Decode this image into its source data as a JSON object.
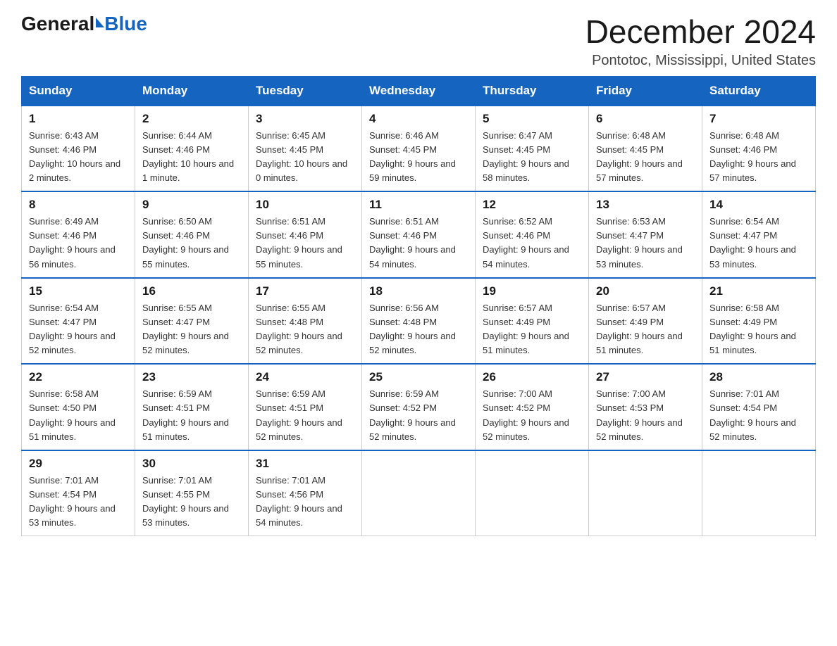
{
  "logo": {
    "general": "General",
    "blue": "Blue"
  },
  "header": {
    "month_title": "December 2024",
    "location": "Pontotoc, Mississippi, United States"
  },
  "days_of_week": [
    "Sunday",
    "Monday",
    "Tuesday",
    "Wednesday",
    "Thursday",
    "Friday",
    "Saturday"
  ],
  "weeks": [
    [
      {
        "day": "1",
        "sunrise": "6:43 AM",
        "sunset": "4:46 PM",
        "daylight": "10 hours and 2 minutes."
      },
      {
        "day": "2",
        "sunrise": "6:44 AM",
        "sunset": "4:46 PM",
        "daylight": "10 hours and 1 minute."
      },
      {
        "day": "3",
        "sunrise": "6:45 AM",
        "sunset": "4:45 PM",
        "daylight": "10 hours and 0 minutes."
      },
      {
        "day": "4",
        "sunrise": "6:46 AM",
        "sunset": "4:45 PM",
        "daylight": "9 hours and 59 minutes."
      },
      {
        "day": "5",
        "sunrise": "6:47 AM",
        "sunset": "4:45 PM",
        "daylight": "9 hours and 58 minutes."
      },
      {
        "day": "6",
        "sunrise": "6:48 AM",
        "sunset": "4:45 PM",
        "daylight": "9 hours and 57 minutes."
      },
      {
        "day": "7",
        "sunrise": "6:48 AM",
        "sunset": "4:46 PM",
        "daylight": "9 hours and 57 minutes."
      }
    ],
    [
      {
        "day": "8",
        "sunrise": "6:49 AM",
        "sunset": "4:46 PM",
        "daylight": "9 hours and 56 minutes."
      },
      {
        "day": "9",
        "sunrise": "6:50 AM",
        "sunset": "4:46 PM",
        "daylight": "9 hours and 55 minutes."
      },
      {
        "day": "10",
        "sunrise": "6:51 AM",
        "sunset": "4:46 PM",
        "daylight": "9 hours and 55 minutes."
      },
      {
        "day": "11",
        "sunrise": "6:51 AM",
        "sunset": "4:46 PM",
        "daylight": "9 hours and 54 minutes."
      },
      {
        "day": "12",
        "sunrise": "6:52 AM",
        "sunset": "4:46 PM",
        "daylight": "9 hours and 54 minutes."
      },
      {
        "day": "13",
        "sunrise": "6:53 AM",
        "sunset": "4:47 PM",
        "daylight": "9 hours and 53 minutes."
      },
      {
        "day": "14",
        "sunrise": "6:54 AM",
        "sunset": "4:47 PM",
        "daylight": "9 hours and 53 minutes."
      }
    ],
    [
      {
        "day": "15",
        "sunrise": "6:54 AM",
        "sunset": "4:47 PM",
        "daylight": "9 hours and 52 minutes."
      },
      {
        "day": "16",
        "sunrise": "6:55 AM",
        "sunset": "4:47 PM",
        "daylight": "9 hours and 52 minutes."
      },
      {
        "day": "17",
        "sunrise": "6:55 AM",
        "sunset": "4:48 PM",
        "daylight": "9 hours and 52 minutes."
      },
      {
        "day": "18",
        "sunrise": "6:56 AM",
        "sunset": "4:48 PM",
        "daylight": "9 hours and 52 minutes."
      },
      {
        "day": "19",
        "sunrise": "6:57 AM",
        "sunset": "4:49 PM",
        "daylight": "9 hours and 51 minutes."
      },
      {
        "day": "20",
        "sunrise": "6:57 AM",
        "sunset": "4:49 PM",
        "daylight": "9 hours and 51 minutes."
      },
      {
        "day": "21",
        "sunrise": "6:58 AM",
        "sunset": "4:49 PM",
        "daylight": "9 hours and 51 minutes."
      }
    ],
    [
      {
        "day": "22",
        "sunrise": "6:58 AM",
        "sunset": "4:50 PM",
        "daylight": "9 hours and 51 minutes."
      },
      {
        "day": "23",
        "sunrise": "6:59 AM",
        "sunset": "4:51 PM",
        "daylight": "9 hours and 51 minutes."
      },
      {
        "day": "24",
        "sunrise": "6:59 AM",
        "sunset": "4:51 PM",
        "daylight": "9 hours and 52 minutes."
      },
      {
        "day": "25",
        "sunrise": "6:59 AM",
        "sunset": "4:52 PM",
        "daylight": "9 hours and 52 minutes."
      },
      {
        "day": "26",
        "sunrise": "7:00 AM",
        "sunset": "4:52 PM",
        "daylight": "9 hours and 52 minutes."
      },
      {
        "day": "27",
        "sunrise": "7:00 AM",
        "sunset": "4:53 PM",
        "daylight": "9 hours and 52 minutes."
      },
      {
        "day": "28",
        "sunrise": "7:01 AM",
        "sunset": "4:54 PM",
        "daylight": "9 hours and 52 minutes."
      }
    ],
    [
      {
        "day": "29",
        "sunrise": "7:01 AM",
        "sunset": "4:54 PM",
        "daylight": "9 hours and 53 minutes."
      },
      {
        "day": "30",
        "sunrise": "7:01 AM",
        "sunset": "4:55 PM",
        "daylight": "9 hours and 53 minutes."
      },
      {
        "day": "31",
        "sunrise": "7:01 AM",
        "sunset": "4:56 PM",
        "daylight": "9 hours and 54 minutes."
      },
      null,
      null,
      null,
      null
    ]
  ]
}
